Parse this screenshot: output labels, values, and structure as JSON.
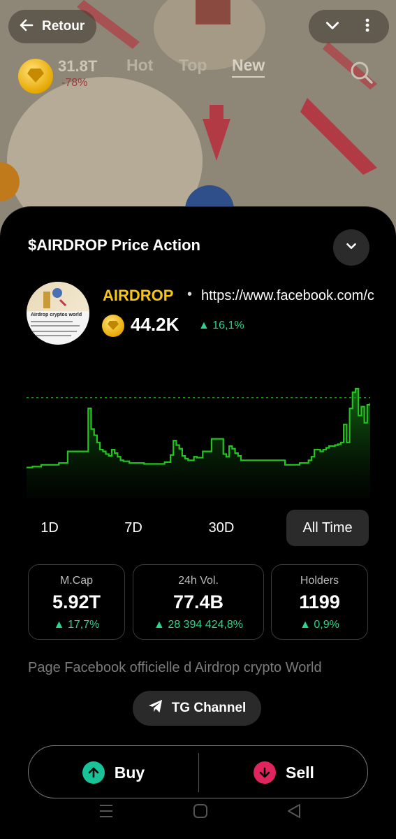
{
  "header": {
    "back_label": "Retour",
    "market_cap": "31.8T",
    "market_change": "-78%",
    "tabs": [
      "Hot",
      "Top",
      "New"
    ]
  },
  "sheet": {
    "title": "$AIRDROP Price Action",
    "token": {
      "name": "AIRDROP",
      "url": "https://www.facebook.com/c",
      "price": "44.2K",
      "change": "16,1%",
      "avatar_title": "Airdrop cryptos world"
    },
    "ranges": [
      "1D",
      "7D",
      "30D",
      "All Time"
    ],
    "active_range": "All Time",
    "stats": [
      {
        "label": "M.Cap",
        "value": "5.92T",
        "change": "17,7%"
      },
      {
        "label": "24h Vol.",
        "value": "77.4B",
        "change": "28 394 424,8%"
      },
      {
        "label": "Holders",
        "value": "1199",
        "change": "0,9%"
      }
    ],
    "description": "Page Facebook officielle d Airdrop crypto World",
    "tg_label": "TG Channel",
    "buy_label": "Buy",
    "sell_label": "Sell"
  },
  "colors": {
    "accent_green": "#2bd58a",
    "chart_line": "#22c41e",
    "token_gold": "#f5c518",
    "buy_circle": "#19c39a",
    "sell_circle": "#e0245e"
  },
  "chart_data": {
    "type": "area",
    "x_ticks": [],
    "y_ticks": [],
    "reference_line": 0.9,
    "values": [
      0.12,
      0.12,
      0.13,
      0.13,
      0.13,
      0.15,
      0.15,
      0.15,
      0.15,
      0.15,
      0.15,
      0.17,
      0.17,
      0.17,
      0.3,
      0.3,
      0.3,
      0.3,
      0.3,
      0.3,
      0.3,
      0.78,
      0.55,
      0.48,
      0.4,
      0.32,
      0.3,
      0.27,
      0.25,
      0.32,
      0.28,
      0.24,
      0.2,
      0.19,
      0.19,
      0.17,
      0.17,
      0.17,
      0.17,
      0.17,
      0.16,
      0.16,
      0.16,
      0.16,
      0.16,
      0.16,
      0.16,
      0.18,
      0.18,
      0.26,
      0.42,
      0.37,
      0.33,
      0.25,
      0.22,
      0.2,
      0.2,
      0.24,
      0.23,
      0.23,
      0.3,
      0.3,
      0.3,
      0.44,
      0.44,
      0.44,
      0.44,
      0.27,
      0.24,
      0.36,
      0.33,
      0.28,
      0.25,
      0.2,
      0.2,
      0.2,
      0.2,
      0.2,
      0.2,
      0.2,
      0.2,
      0.2,
      0.2,
      0.2,
      0.2,
      0.2,
      0.2,
      0.2,
      0.15,
      0.15,
      0.15,
      0.15,
      0.15,
      0.17,
      0.17,
      0.17,
      0.2,
      0.24,
      0.32,
      0.32,
      0.3,
      0.32,
      0.34,
      0.36,
      0.36,
      0.37,
      0.38,
      0.4,
      0.6,
      0.4,
      0.78,
      0.96,
      1.0,
      0.7,
      0.8,
      0.62,
      0.82,
      0.84
    ]
  }
}
